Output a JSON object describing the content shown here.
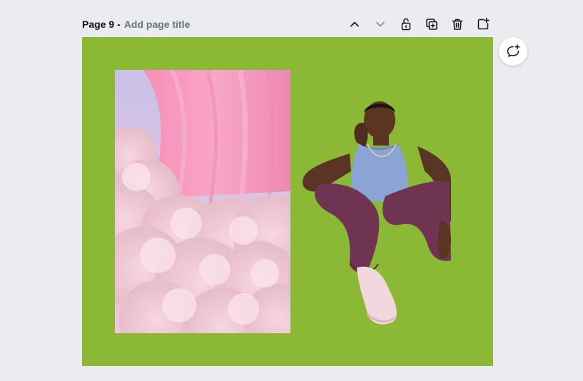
{
  "page_header": {
    "page_label": "Page 9",
    "separator": "-",
    "title_placeholder": "Add page title"
  },
  "toolbar": {
    "items": [
      {
        "name": "move-page-up",
        "icon": "chevron-up-icon",
        "enabled": true
      },
      {
        "name": "move-page-down",
        "icon": "chevron-down-icon",
        "enabled": false
      },
      {
        "name": "lock-page",
        "icon": "unlock-icon",
        "enabled": true
      },
      {
        "name": "duplicate-page",
        "icon": "duplicate-icon",
        "enabled": true
      },
      {
        "name": "delete-page",
        "icon": "trash-icon",
        "enabled": true
      },
      {
        "name": "add-page",
        "icon": "add-page-icon",
        "enabled": true
      }
    ]
  },
  "canvas": {
    "background_color": "#8cb935",
    "elements": [
      {
        "name": "cloud-curtain-photo",
        "type": "image",
        "description_icon": "image-icon"
      },
      {
        "name": "seated-man-cutout",
        "type": "image",
        "description_icon": "image-icon"
      }
    ]
  },
  "comment_button": {
    "icon": "add-comment-icon"
  },
  "colors": {
    "workspace_bg": "#ebecf0",
    "canvas_bg": "#8cb935",
    "icon_color": "#0e1318",
    "title_placeholder_color": "#6b7280"
  }
}
